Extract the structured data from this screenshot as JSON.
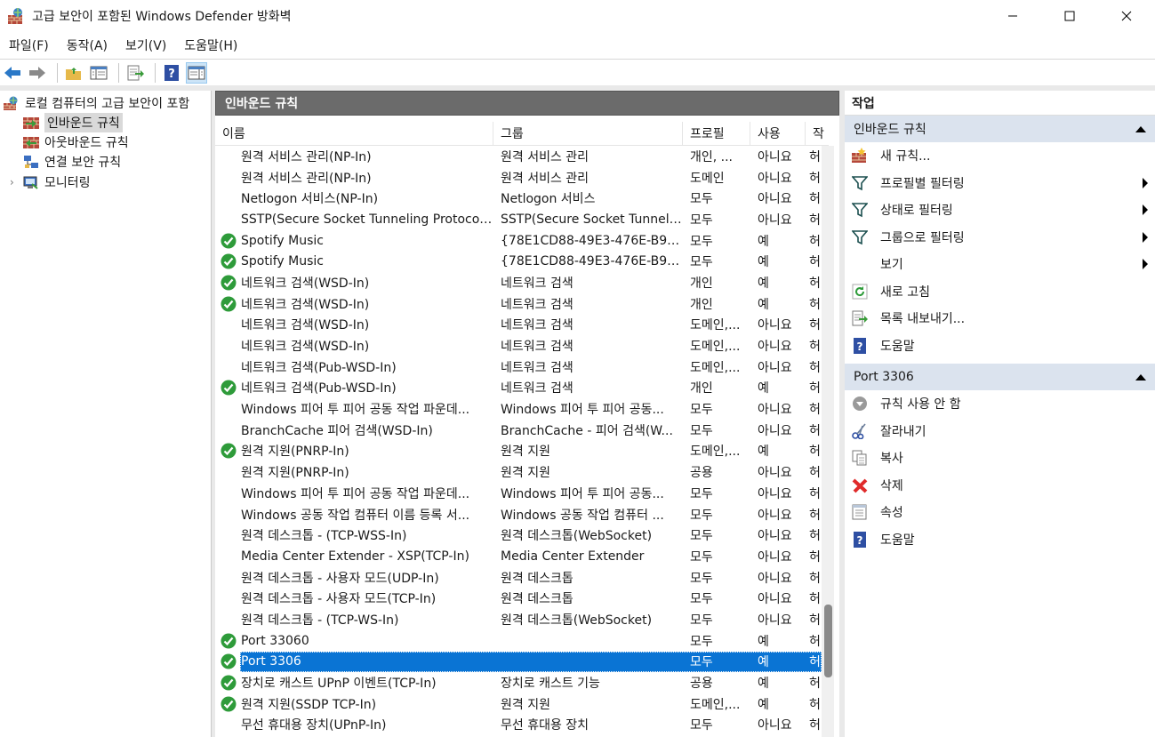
{
  "window": {
    "title": "고급 보안이 포함된 Windows Defender 방화벽"
  },
  "menu": [
    "파일(F)",
    "동작(A)",
    "보기(V)",
    "도움말(H)"
  ],
  "tree": {
    "root": "로컬 컴퓨터의 고급 보안이 포함",
    "items": [
      "인바운드 규칙",
      "아웃바운드 규칙",
      "연결 보안 규칙",
      "모니터링"
    ]
  },
  "center": {
    "title": "인바운드 규칙",
    "columns": [
      "이름",
      "그룹",
      "프로필",
      "사용",
      "작"
    ],
    "rows": [
      {
        "enabled": false,
        "name": "원격 서비스 관리(NP-In)",
        "group": "원격 서비스 관리",
        "profile": "개인, ...",
        "use": "아니요",
        "action": "허"
      },
      {
        "enabled": false,
        "name": "원격 서비스 관리(NP-In)",
        "group": "원격 서비스 관리",
        "profile": "도메인",
        "use": "아니요",
        "action": "허"
      },
      {
        "enabled": false,
        "name": "Netlogon 서비스(NP-In)",
        "group": "Netlogon 서비스",
        "profile": "모두",
        "use": "아니요",
        "action": "허"
      },
      {
        "enabled": false,
        "name": "SSTP(Secure Socket Tunneling Protocol)(S...",
        "group": "SSTP(Secure Socket Tunnelin...",
        "profile": "모두",
        "use": "아니요",
        "action": "허"
      },
      {
        "enabled": true,
        "name": "Spotify Music",
        "group": "{78E1CD88-49E3-476E-B926-...",
        "profile": "모두",
        "use": "예",
        "action": "허"
      },
      {
        "enabled": true,
        "name": "Spotify Music",
        "group": "{78E1CD88-49E3-476E-B926-...",
        "profile": "모두",
        "use": "예",
        "action": "허"
      },
      {
        "enabled": true,
        "name": "네트워크 검색(WSD-In)",
        "group": "네트워크 검색",
        "profile": "개인",
        "use": "예",
        "action": "허"
      },
      {
        "enabled": true,
        "name": "네트워크 검색(WSD-In)",
        "group": "네트워크 검색",
        "profile": "개인",
        "use": "예",
        "action": "허"
      },
      {
        "enabled": false,
        "name": "네트워크 검색(WSD-In)",
        "group": "네트워크 검색",
        "profile": "도메인,...",
        "use": "아니요",
        "action": "허"
      },
      {
        "enabled": false,
        "name": "네트워크 검색(WSD-In)",
        "group": "네트워크 검색",
        "profile": "도메인,...",
        "use": "아니요",
        "action": "허"
      },
      {
        "enabled": false,
        "name": "네트워크 검색(Pub-WSD-In)",
        "group": "네트워크 검색",
        "profile": "도메인,...",
        "use": "아니요",
        "action": "허"
      },
      {
        "enabled": true,
        "name": "네트워크 검색(Pub-WSD-In)",
        "group": "네트워크 검색",
        "profile": "개인",
        "use": "예",
        "action": "허"
      },
      {
        "enabled": false,
        "name": "Windows 피어 투 피어 공동 작업 파운데...",
        "group": "Windows 피어 투 피어 공동...",
        "profile": "모두",
        "use": "아니요",
        "action": "허"
      },
      {
        "enabled": false,
        "name": "BranchCache 피어 검색(WSD-In)",
        "group": "BranchCache - 피어 검색(W...",
        "profile": "모두",
        "use": "아니요",
        "action": "허"
      },
      {
        "enabled": true,
        "name": "원격 지원(PNRP-In)",
        "group": "원격 지원",
        "profile": "도메인,...",
        "use": "예",
        "action": "허"
      },
      {
        "enabled": false,
        "name": "원격 지원(PNRP-In)",
        "group": "원격 지원",
        "profile": "공용",
        "use": "아니요",
        "action": "허"
      },
      {
        "enabled": false,
        "name": "Windows 피어 투 피어 공동 작업 파운데...",
        "group": "Windows 피어 투 피어 공동...",
        "profile": "모두",
        "use": "아니요",
        "action": "허"
      },
      {
        "enabled": false,
        "name": "Windows 공동 작업 컴퓨터 이름 등록 서...",
        "group": "Windows 공동 작업 컴퓨터 ...",
        "profile": "모두",
        "use": "아니요",
        "action": "허"
      },
      {
        "enabled": false,
        "name": "원격 데스크톱 - (TCP-WSS-In)",
        "group": "원격 데스크톱(WebSocket)",
        "profile": "모두",
        "use": "아니요",
        "action": "허"
      },
      {
        "enabled": false,
        "name": "Media Center Extender - XSP(TCP-In)",
        "group": "Media Center Extender",
        "profile": "모두",
        "use": "아니요",
        "action": "허"
      },
      {
        "enabled": false,
        "name": "원격 데스크톱 - 사용자 모드(UDP-In)",
        "group": "원격 데스크톱",
        "profile": "모두",
        "use": "아니요",
        "action": "허"
      },
      {
        "enabled": false,
        "name": "원격 데스크톱 - 사용자 모드(TCP-In)",
        "group": "원격 데스크톱",
        "profile": "모두",
        "use": "아니요",
        "action": "허"
      },
      {
        "enabled": false,
        "name": "원격 데스크톱 - (TCP-WS-In)",
        "group": "원격 데스크톱(WebSocket)",
        "profile": "모두",
        "use": "아니요",
        "action": "허"
      },
      {
        "enabled": true,
        "name": "Port 33060",
        "group": "",
        "profile": "모두",
        "use": "예",
        "action": "허"
      },
      {
        "enabled": true,
        "name": "Port 3306",
        "group": "",
        "profile": "모두",
        "use": "예",
        "action": "허",
        "selected": true
      },
      {
        "enabled": true,
        "name": "장치로 캐스트 UPnP 이벤트(TCP-In)",
        "group": "장치로 캐스트 기능",
        "profile": "공용",
        "use": "예",
        "action": "허"
      },
      {
        "enabled": true,
        "name": "원격 지원(SSDP TCP-In)",
        "group": "원격 지원",
        "profile": "도메인,...",
        "use": "예",
        "action": "허"
      },
      {
        "enabled": false,
        "name": "무선 휴대용 장치(UPnP-In)",
        "group": "무선 휴대용 장치",
        "profile": "모두",
        "use": "아니요",
        "action": "허"
      }
    ]
  },
  "actions": {
    "title": "작업",
    "section1": {
      "label": "인바운드 규칙",
      "items": [
        "새 규칙...",
        "프로필별 필터링",
        "상태로 필터링",
        "그룹으로 필터링",
        "보기",
        "새로 고침",
        "목록 내보내기...",
        "도움말"
      ]
    },
    "section2": {
      "label": "Port 3306",
      "items": [
        "규칙 사용 안 함",
        "잘라내기",
        "복사",
        "삭제",
        "속성",
        "도움말"
      ]
    }
  },
  "colors": {
    "accent": "#0a74d4",
    "check": "#2e9b3a",
    "header": "#6b6b6b",
    "section": "#dbe3ee"
  }
}
